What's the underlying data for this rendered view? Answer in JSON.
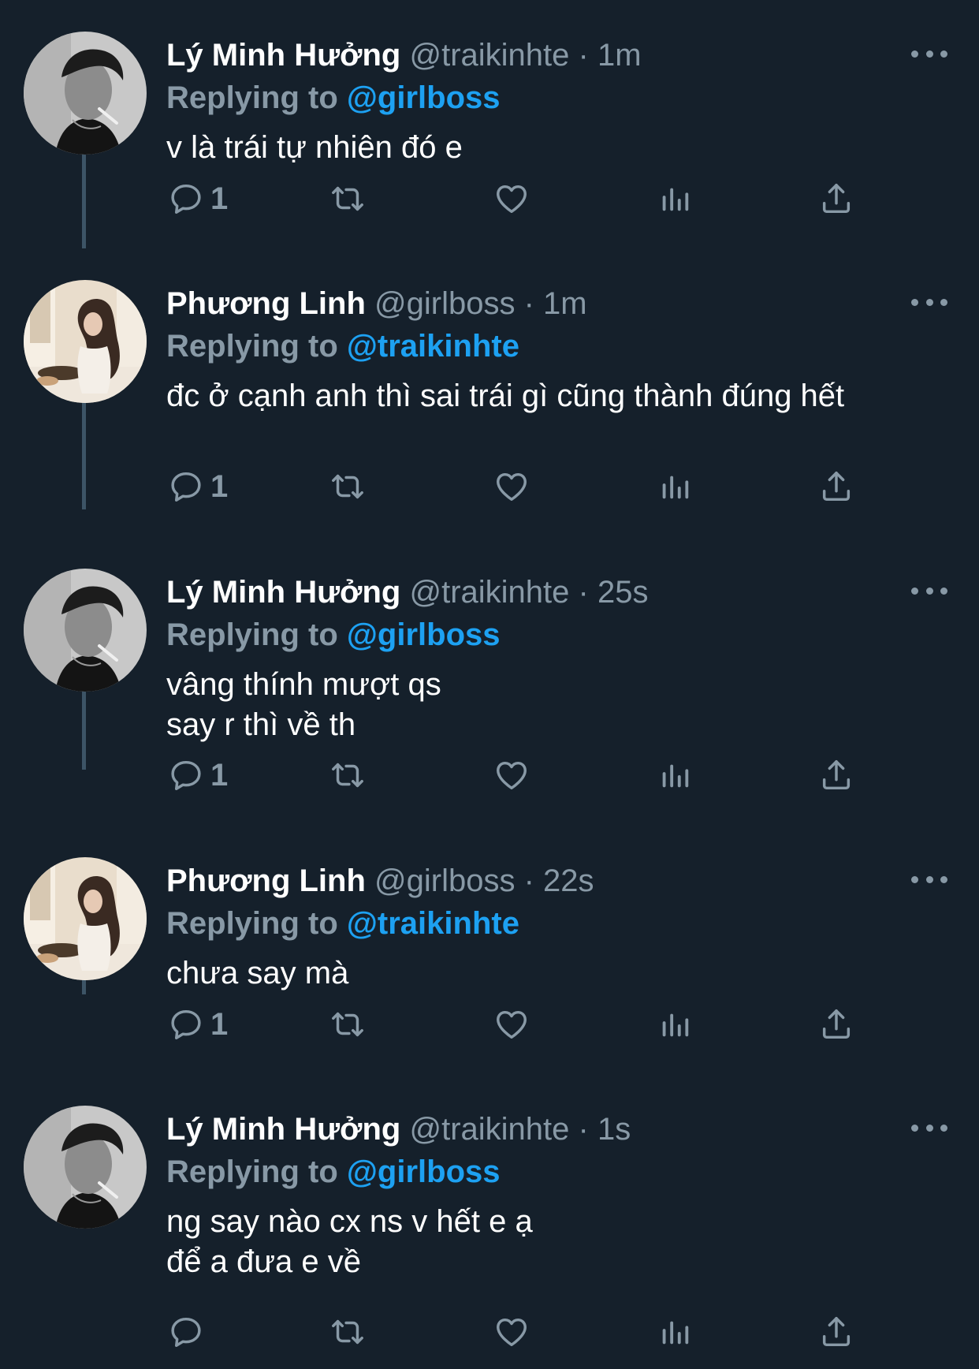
{
  "colors": {
    "background": "#15202b",
    "text_primary": "#ffffff",
    "text_secondary": "#8899a6",
    "accent": "#1da1f2",
    "thread_line": "#3d5466"
  },
  "icons": {
    "reply": "reply-icon",
    "retweet": "retweet-icon",
    "like": "heart-icon",
    "analytics": "analytics-icon",
    "share": "share-icon",
    "more": "more-icon"
  },
  "tweets": [
    {
      "name": "Lý Minh Hưởng",
      "meta": "@traikinhte · 1m",
      "reply_prefix": "Replying to",
      "reply_handle": "@girlboss",
      "text": "v là trái tự nhiên đó e",
      "reply_count": "1"
    },
    {
      "name": "Phương Linh",
      "meta": "@girlboss · 1m",
      "reply_prefix": "Replying to",
      "reply_handle": "@traikinhte",
      "text": "đc ở cạnh anh thì sai trái gì cũng thành đúng hết",
      "reply_count": "1"
    },
    {
      "name": "Lý Minh Hưởng",
      "meta": "@traikinhte · 25s",
      "reply_prefix": "Replying to",
      "reply_handle": "@girlboss",
      "text": "vâng thính mượt qs\nsay r thì về th",
      "reply_count": "1"
    },
    {
      "name": "Phương Linh",
      "meta": "@girlboss · 22s",
      "reply_prefix": "Replying to",
      "reply_handle": "@traikinhte",
      "text": "chưa say mà",
      "reply_count": "1"
    },
    {
      "name": "Lý Minh Hưởng",
      "meta": "@traikinhte · 1s",
      "reply_prefix": "Replying to",
      "reply_handle": "@girlboss",
      "text": "ng say nào cx ns v hết e ạ\nđể a đưa e về",
      "reply_count": ""
    }
  ]
}
